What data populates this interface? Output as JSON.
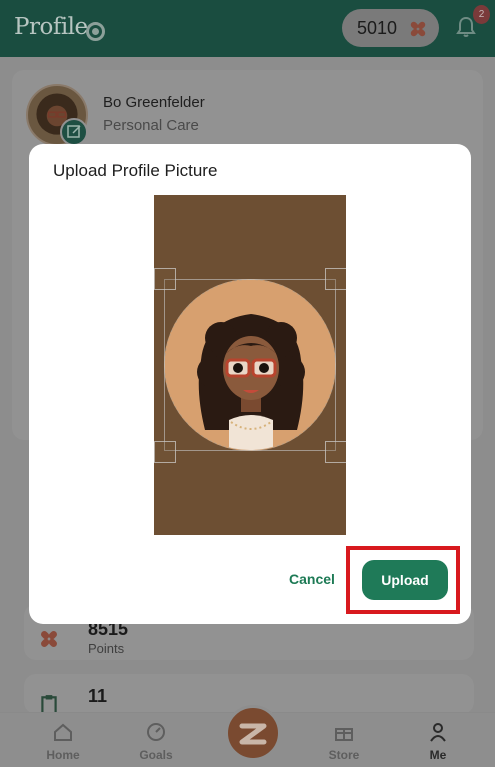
{
  "header": {
    "title": "Profile",
    "points": "5010",
    "notification_count": "2"
  },
  "profile": {
    "name": "Bo Greenfelder",
    "role": "Personal Care"
  },
  "stats": [
    {
      "value": "8515",
      "label": "Points",
      "icon": "flower-icon"
    },
    {
      "value": "11",
      "label": "",
      "icon": "clipboard-icon"
    }
  ],
  "modal": {
    "title": "Upload Profile Picture",
    "cancel_label": "Cancel",
    "upload_label": "Upload"
  },
  "nav": {
    "items": [
      {
        "label": "Home",
        "icon": "home-icon"
      },
      {
        "label": "Goals",
        "icon": "gauge-icon"
      },
      {
        "label": "Store",
        "icon": "gift-icon"
      },
      {
        "label": "Me",
        "icon": "person-icon"
      }
    ]
  },
  "colors": {
    "primary": "#1f7a58",
    "header_bg": "#1a4d40",
    "highlight": "#d8191e",
    "crop_bg": "#6d4f33"
  }
}
